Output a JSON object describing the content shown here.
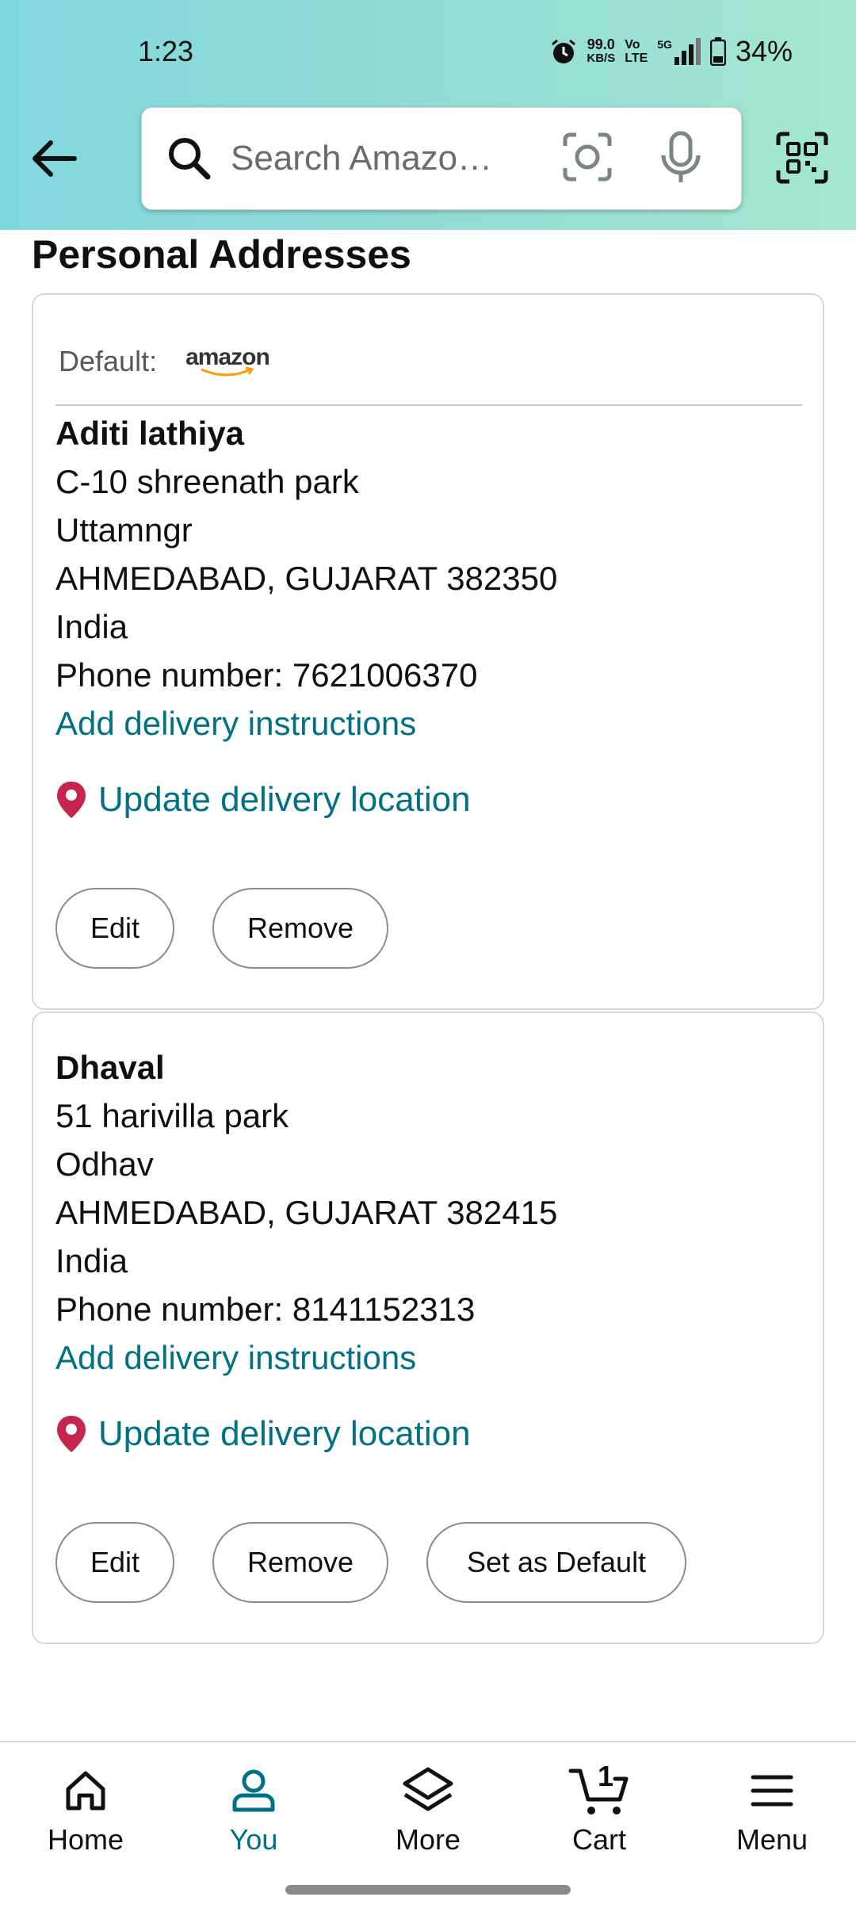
{
  "status_bar": {
    "time": "1:23",
    "net_speed_value": "99.0",
    "net_speed_unit": "KB/S",
    "volte": "Vo\nLTE",
    "network": "5G",
    "battery": "34%"
  },
  "header": {
    "search_placeholder": "Search Amazo…"
  },
  "page": {
    "title": "Personal Addresses"
  },
  "addresses": [
    {
      "default_label": "Default:",
      "default_brand": "amazon",
      "name": "Aditi lathiya",
      "line1": "C-10 shreenath park",
      "line2": "Uttamngr",
      "city_state_zip": "AHMEDABAD, GUJARAT 382350",
      "country": "India",
      "phone": "Phone number: 7621006370",
      "add_instructions": "Add delivery instructions",
      "update_location": "Update delivery location",
      "edit_label": "Edit",
      "remove_label": "Remove"
    },
    {
      "name": "Dhaval",
      "line1": "51 harivilla park",
      "line2": "Odhav",
      "city_state_zip": "AHMEDABAD, GUJARAT 382415",
      "country": "India",
      "phone": "Phone number: 8141152313",
      "add_instructions": "Add delivery instructions",
      "update_location": "Update delivery location",
      "edit_label": "Edit",
      "remove_label": "Remove",
      "set_default_label": "Set as Default"
    }
  ],
  "bottom_nav": [
    {
      "label": "Home",
      "icon": "home-icon",
      "active": false
    },
    {
      "label": "You",
      "icon": "person-icon",
      "active": true
    },
    {
      "label": "More",
      "icon": "layers-icon",
      "active": false
    },
    {
      "label": "Cart",
      "icon": "cart-icon",
      "active": false,
      "badge": "1"
    },
    {
      "label": "Menu",
      "icon": "menu-icon",
      "active": false
    }
  ],
  "colors": {
    "accent": "#007185",
    "pin": "#c7254e",
    "header_gradient_start": "#80d8de",
    "header_gradient_end": "#a5e7cf"
  }
}
